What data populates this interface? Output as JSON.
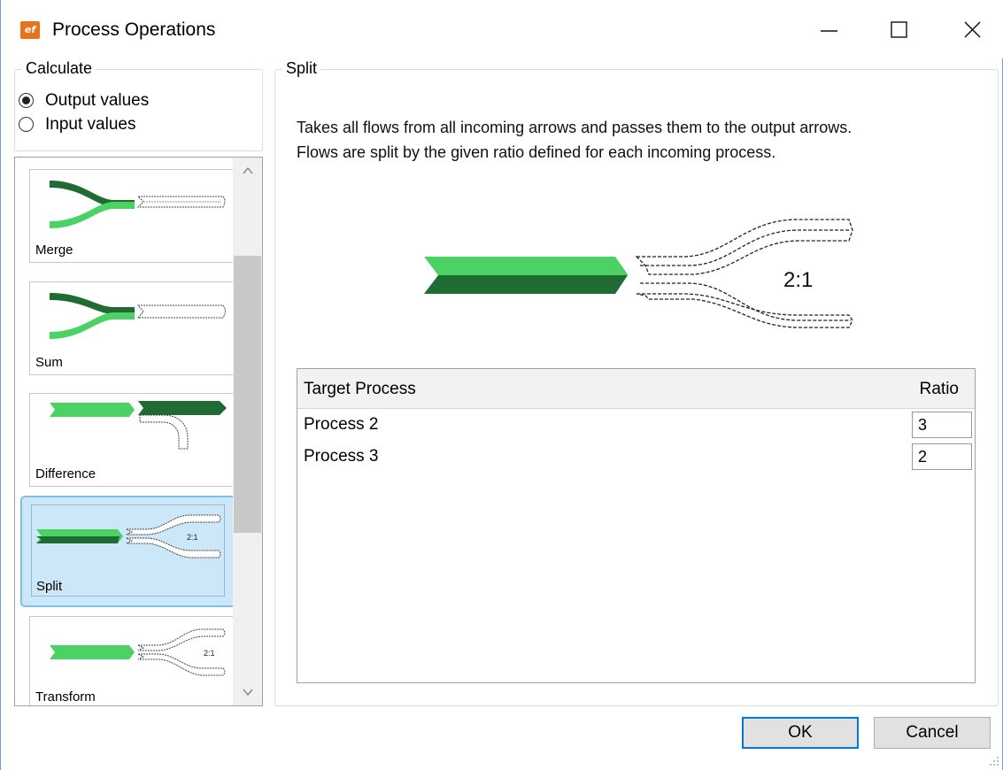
{
  "window": {
    "title": "Process Operations",
    "icon": "ef-app-icon",
    "icon_text": "ef",
    "controls": [
      "minimize-icon",
      "maximize-icon",
      "close-icon"
    ]
  },
  "calculate": {
    "legend": "Calculate",
    "options": [
      {
        "label": "Output values",
        "checked": true
      },
      {
        "label": "Input values",
        "checked": false
      }
    ]
  },
  "operations": {
    "items": [
      {
        "label": "Merge",
        "selected": false
      },
      {
        "label": "Sum",
        "selected": false
      },
      {
        "label": "Difference",
        "selected": false
      },
      {
        "label": "Split",
        "selected": true
      },
      {
        "label": "Transform",
        "selected": false
      }
    ],
    "thumb_ratio_text": "2:1"
  },
  "split": {
    "legend": "Split",
    "description_line1": "Takes all flows from all incoming arrows and passes them to the output arrows.",
    "description_line2": "Flows are split by the given ratio defined for each incoming process.",
    "diagram_ratio": "2:1",
    "table": {
      "headers": {
        "target": "Target Process",
        "ratio": "Ratio"
      },
      "rows": [
        {
          "name": "Process 2",
          "ratio": "3"
        },
        {
          "name": "Process 3",
          "ratio": "2"
        }
      ]
    }
  },
  "buttons": {
    "ok": "OK",
    "cancel": "Cancel"
  },
  "colors": {
    "flow_light": "#4cd264",
    "flow_dark": "#1f6b33",
    "selection_bg": "#cce8f8",
    "selection_border": "#7fc0e8",
    "accent": "#0078d7"
  }
}
